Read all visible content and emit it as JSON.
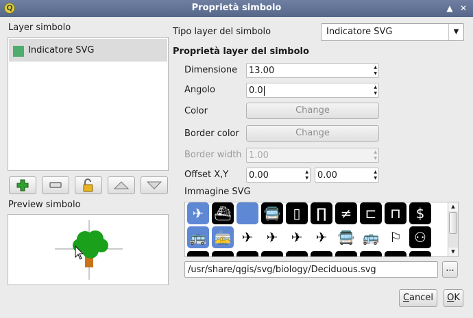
{
  "window": {
    "title": "Proprietà simbolo",
    "icon_letter": "Q"
  },
  "left": {
    "layers_label": "Layer simbolo",
    "layers": [
      {
        "name": "Indicatore SVG",
        "color": "#4ead6c"
      }
    ],
    "toolbar_icons": [
      "add-layer-icon",
      "remove-layer-icon",
      "lock-icon",
      "move-up-icon",
      "move-down-icon"
    ],
    "preview_label": "Preview simbolo"
  },
  "right": {
    "type_label": "Tipo layer del simbolo",
    "type_value": "Indicatore SVG",
    "section_title": "Proprietà layer del simbolo",
    "size_label": "Dimensione",
    "size_value": "13.00",
    "angle_label": "Angolo",
    "angle_value": "0.0",
    "color_label": "Color",
    "color_button": "Change",
    "border_color_label": "Border color",
    "border_color_button": "Change",
    "border_width_label": "Border width",
    "border_width_value": "1.00",
    "offset_label": "Offset X,Y",
    "offset_x": "0.00",
    "offset_y": "0.00",
    "svg_label": "Immagine SVG",
    "svg_icons": [
      "airplane-icon",
      "ferry-icon",
      "blank-icon",
      "bus-front-icon",
      "doorway-icon",
      "gate-icon",
      "no-entry-icon",
      "barrier-icon",
      "bench-icon",
      "money-exchange-icon",
      "bus-icon",
      "tram-icon",
      "airplane-icon",
      "airplane-icon",
      "airplane-icon",
      "airplane-icon",
      "bus-front-icon",
      "bus-icon",
      "bus-stop-icon",
      "people-icon",
      "symbol-icon",
      "symbol-icon",
      "symbol-icon",
      "symbol-icon",
      "symbol-icon",
      "symbol-icon",
      "symbol-icon",
      "symbol-icon",
      "symbol-icon",
      "symbol-icon"
    ],
    "svg_path": "/usr/share/qgis/svg/biology/Deciduous.svg",
    "browse_label": "..."
  },
  "buttons": {
    "cancel_first": "C",
    "cancel_rest": "ancel",
    "ok_first": "O",
    "ok_rest": "K"
  },
  "colors": {
    "layer_swatch": "#4ead6c",
    "tree_crown": "#1aa01a",
    "tree_trunk": "#c8731a",
    "svg_highlight": "#5f88d4"
  }
}
